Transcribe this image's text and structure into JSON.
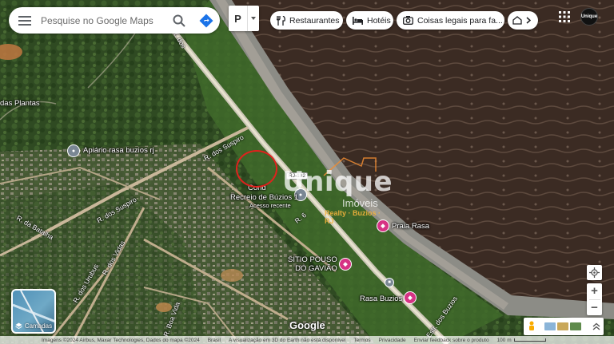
{
  "search": {
    "placeholder": "Pesquise no Google Maps"
  },
  "mode_label": "P",
  "chips": [
    {
      "label": "Restaurantes",
      "icon": "fork-knife-icon"
    },
    {
      "label": "Hotéis",
      "icon": "bed-icon"
    },
    {
      "label": "Coisas legais para fa...",
      "icon": "camera-icon"
    }
  ],
  "avatar_text": "Unique",
  "map_labels": {
    "das_plantas": "das Plantas",
    "apiario": "Apiário rasa buzios rj",
    "praia_rasa": "Praia Rasa",
    "sitio": "SITIO POUSO\nDO GAVIÃO",
    "rasa_buzios": "Rasa Buzios",
    "recreio": "Recreio de Búzios 1",
    "recreio_sub": "Acesso recente",
    "cond": "Cond",
    "route_badge": "RJ-102"
  },
  "road_labels": {
    "r_suspiro_a": "R. dos Suspiro",
    "r_suspiro_b": "R. dos Suspiro",
    "r_batalha": "R. da Batalha",
    "r_vidas": "R. dos Vidas",
    "r_urubus": "R. dos Urubus",
    "r_boa_vida": "R. Boa Vida",
    "r_6": "R. 6",
    "estr_buzios": "Estr. dos Buzios",
    "r_top": "R. dos"
  },
  "watermark": {
    "title": "Unique",
    "subtitle": "Imóveis",
    "tag": "Realty · Buzios · RJ"
  },
  "layers_label": "Camadas",
  "google_logo": "Google",
  "footer": {
    "imagery": "Imagens ©2024 Airbus, Maxar Technologies, Dados do mapa ©2024",
    "country": "Brasil",
    "notice": "A visualização em 3D do Earth não está disponível",
    "terms": "Termos",
    "privacy": "Privacidade",
    "feedback": "Enviar feedback sobre o produto",
    "scale": "100 m"
  },
  "colors": {
    "red_circle": "#e0211d",
    "poi_pink": "#d63384",
    "poi_grey": "#7a8794",
    "sea": "#3a2a22"
  }
}
